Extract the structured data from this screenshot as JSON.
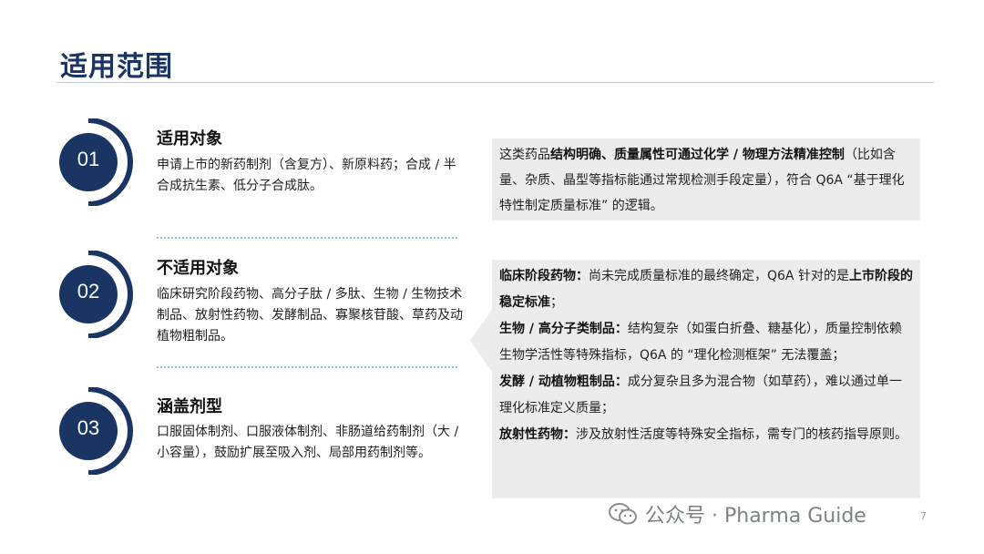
{
  "page_title": "适用范围",
  "items": [
    {
      "num": "01",
      "title": "适用对象",
      "desc": "申请上市的新药制剂（含复方）、新原料药；合成 / 半合成抗生素、低分子合成肽。"
    },
    {
      "num": "02",
      "title": "不适用对象",
      "desc": "临床研究阶段药物、高分子肽 / 多肽、生物 / 生物技术制品、放射性药物、发酵制品、寡聚核苷酸、草药及动植物粗制品。"
    },
    {
      "num": "03",
      "title": "涵盖剂型",
      "desc": "口服固体制剂、口服液体制剂、非肠道给药制剂（大 / 小容量），鼓励扩展至吸入剂、局部用药制剂等。"
    }
  ],
  "note1": {
    "p1": "这类药品",
    "b1": "结构明确、质量属性可通过化学 / 物理方法精准控制",
    "p2": "（比如含量、杂质、晶型等指标能通过常规检测手段定量），符合 Q6A “基于理化特性制定质量标准” 的逻辑。"
  },
  "note2": {
    "l1_label": "临床阶段药物：",
    "l1_text": "尚未完成质量标准的最终确定，Q6A 针对的是",
    "l1_bold": "上市阶段的稳定标准",
    "l1_end": "；",
    "l2_label": "生物 / 高分子类制品：",
    "l2_text": "结构复杂（如蛋白折叠、糖基化），质量控制依赖生物学活性等特殊指标，Q6A 的 “理化检测框架” 无法覆盖；",
    "l3_label": "发酵 / 动植物粗制品：",
    "l3_text": "成分复杂且多为混合物（如草药），难以通过单一理化标准定义质量；",
    "l4_label": "放射性药物：",
    "l4_text": "涉及放射性活度等特殊安全指标，需专门的核药指导原则。"
  },
  "watermark": "公众号 · Pharma Guide",
  "page_number": "7",
  "colors": {
    "primary": "#1a3564",
    "note_bg": "#ececed",
    "divider": "#7fc2e6"
  }
}
